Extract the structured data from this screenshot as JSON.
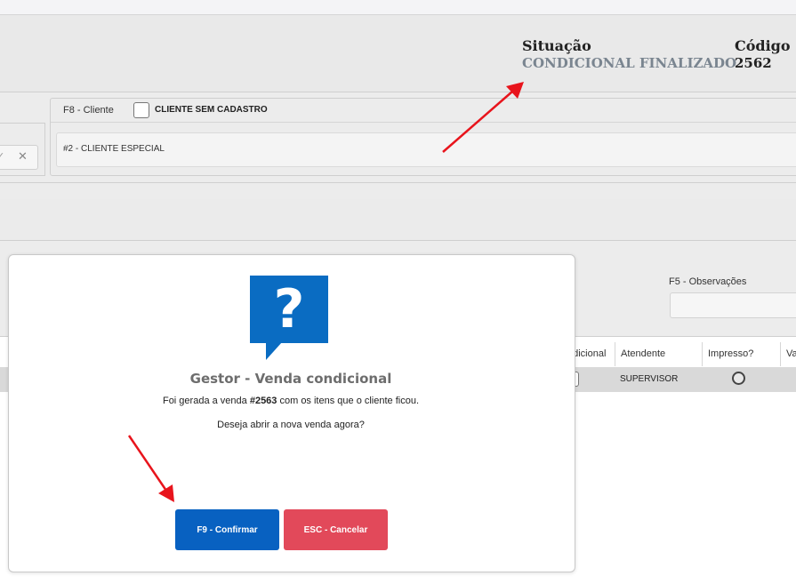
{
  "header": {
    "situacao_label": "Situação",
    "situacao_value": "CONDICIONAL FINALIZADO",
    "codigo_label": "Código",
    "codigo_value": "2562"
  },
  "cliente": {
    "f8_label": "F8 - Cliente",
    "sem_cadastro_label": "CLIENTE SEM CADASTRO",
    "field_value": "#2 - CLIENTE ESPECIAL"
  },
  "left_field": {
    "check_icon": "✓",
    "clear_icon": "✕"
  },
  "observacoes": {
    "label": "F5 - Observações",
    "value": ""
  },
  "table": {
    "columns": [
      "ndicional",
      "Atendente",
      "Impresso?",
      "Va"
    ],
    "row": {
      "atendente": "SUPERVISOR"
    }
  },
  "modal": {
    "icon": "question-icon",
    "icon_glyph": "?",
    "title": "Gestor - Venda condicional",
    "line1_prefix": "Foi gerada a venda ",
    "line1_number": "#2563",
    "line1_suffix": " com os itens que o cliente ficou.",
    "line2": "Deseja abrir a nova venda agora?",
    "confirm_label": "F9 - Confirmar",
    "cancel_label": "ESC - Cancelar"
  },
  "colors": {
    "primary": "#0861c1",
    "danger": "#e2495a",
    "icon_blue": "#0a6cc2",
    "annotation_arrow": "#e8141c"
  }
}
